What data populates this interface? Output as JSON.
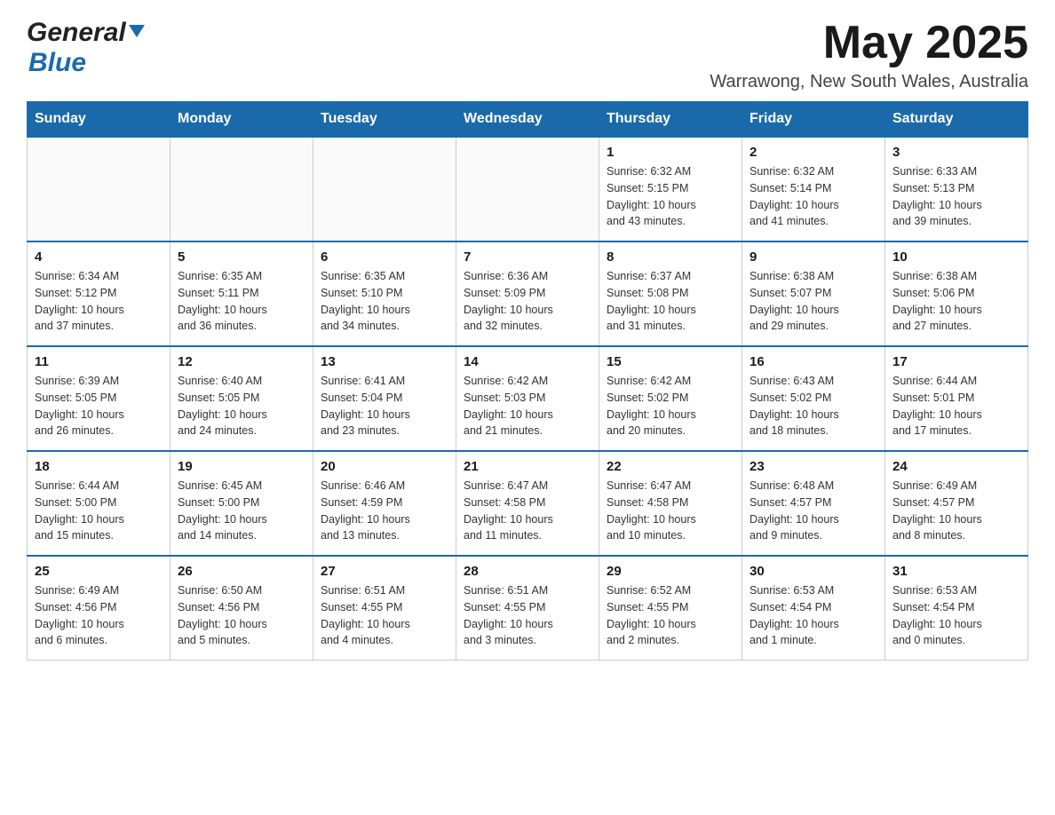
{
  "header": {
    "logo_general": "General",
    "logo_blue": "Blue",
    "month_title": "May 2025",
    "location": "Warrawong, New South Wales, Australia"
  },
  "days_of_week": [
    "Sunday",
    "Monday",
    "Tuesday",
    "Wednesday",
    "Thursday",
    "Friday",
    "Saturday"
  ],
  "weeks": [
    [
      {
        "day": "",
        "info": ""
      },
      {
        "day": "",
        "info": ""
      },
      {
        "day": "",
        "info": ""
      },
      {
        "day": "",
        "info": ""
      },
      {
        "day": "1",
        "info": "Sunrise: 6:32 AM\nSunset: 5:15 PM\nDaylight: 10 hours\nand 43 minutes."
      },
      {
        "day": "2",
        "info": "Sunrise: 6:32 AM\nSunset: 5:14 PM\nDaylight: 10 hours\nand 41 minutes."
      },
      {
        "day": "3",
        "info": "Sunrise: 6:33 AM\nSunset: 5:13 PM\nDaylight: 10 hours\nand 39 minutes."
      }
    ],
    [
      {
        "day": "4",
        "info": "Sunrise: 6:34 AM\nSunset: 5:12 PM\nDaylight: 10 hours\nand 37 minutes."
      },
      {
        "day": "5",
        "info": "Sunrise: 6:35 AM\nSunset: 5:11 PM\nDaylight: 10 hours\nand 36 minutes."
      },
      {
        "day": "6",
        "info": "Sunrise: 6:35 AM\nSunset: 5:10 PM\nDaylight: 10 hours\nand 34 minutes."
      },
      {
        "day": "7",
        "info": "Sunrise: 6:36 AM\nSunset: 5:09 PM\nDaylight: 10 hours\nand 32 minutes."
      },
      {
        "day": "8",
        "info": "Sunrise: 6:37 AM\nSunset: 5:08 PM\nDaylight: 10 hours\nand 31 minutes."
      },
      {
        "day": "9",
        "info": "Sunrise: 6:38 AM\nSunset: 5:07 PM\nDaylight: 10 hours\nand 29 minutes."
      },
      {
        "day": "10",
        "info": "Sunrise: 6:38 AM\nSunset: 5:06 PM\nDaylight: 10 hours\nand 27 minutes."
      }
    ],
    [
      {
        "day": "11",
        "info": "Sunrise: 6:39 AM\nSunset: 5:05 PM\nDaylight: 10 hours\nand 26 minutes."
      },
      {
        "day": "12",
        "info": "Sunrise: 6:40 AM\nSunset: 5:05 PM\nDaylight: 10 hours\nand 24 minutes."
      },
      {
        "day": "13",
        "info": "Sunrise: 6:41 AM\nSunset: 5:04 PM\nDaylight: 10 hours\nand 23 minutes."
      },
      {
        "day": "14",
        "info": "Sunrise: 6:42 AM\nSunset: 5:03 PM\nDaylight: 10 hours\nand 21 minutes."
      },
      {
        "day": "15",
        "info": "Sunrise: 6:42 AM\nSunset: 5:02 PM\nDaylight: 10 hours\nand 20 minutes."
      },
      {
        "day": "16",
        "info": "Sunrise: 6:43 AM\nSunset: 5:02 PM\nDaylight: 10 hours\nand 18 minutes."
      },
      {
        "day": "17",
        "info": "Sunrise: 6:44 AM\nSunset: 5:01 PM\nDaylight: 10 hours\nand 17 minutes."
      }
    ],
    [
      {
        "day": "18",
        "info": "Sunrise: 6:44 AM\nSunset: 5:00 PM\nDaylight: 10 hours\nand 15 minutes."
      },
      {
        "day": "19",
        "info": "Sunrise: 6:45 AM\nSunset: 5:00 PM\nDaylight: 10 hours\nand 14 minutes."
      },
      {
        "day": "20",
        "info": "Sunrise: 6:46 AM\nSunset: 4:59 PM\nDaylight: 10 hours\nand 13 minutes."
      },
      {
        "day": "21",
        "info": "Sunrise: 6:47 AM\nSunset: 4:58 PM\nDaylight: 10 hours\nand 11 minutes."
      },
      {
        "day": "22",
        "info": "Sunrise: 6:47 AM\nSunset: 4:58 PM\nDaylight: 10 hours\nand 10 minutes."
      },
      {
        "day": "23",
        "info": "Sunrise: 6:48 AM\nSunset: 4:57 PM\nDaylight: 10 hours\nand 9 minutes."
      },
      {
        "day": "24",
        "info": "Sunrise: 6:49 AM\nSunset: 4:57 PM\nDaylight: 10 hours\nand 8 minutes."
      }
    ],
    [
      {
        "day": "25",
        "info": "Sunrise: 6:49 AM\nSunset: 4:56 PM\nDaylight: 10 hours\nand 6 minutes."
      },
      {
        "day": "26",
        "info": "Sunrise: 6:50 AM\nSunset: 4:56 PM\nDaylight: 10 hours\nand 5 minutes."
      },
      {
        "day": "27",
        "info": "Sunrise: 6:51 AM\nSunset: 4:55 PM\nDaylight: 10 hours\nand 4 minutes."
      },
      {
        "day": "28",
        "info": "Sunrise: 6:51 AM\nSunset: 4:55 PM\nDaylight: 10 hours\nand 3 minutes."
      },
      {
        "day": "29",
        "info": "Sunrise: 6:52 AM\nSunset: 4:55 PM\nDaylight: 10 hours\nand 2 minutes."
      },
      {
        "day": "30",
        "info": "Sunrise: 6:53 AM\nSunset: 4:54 PM\nDaylight: 10 hours\nand 1 minute."
      },
      {
        "day": "31",
        "info": "Sunrise: 6:53 AM\nSunset: 4:54 PM\nDaylight: 10 hours\nand 0 minutes."
      }
    ]
  ]
}
